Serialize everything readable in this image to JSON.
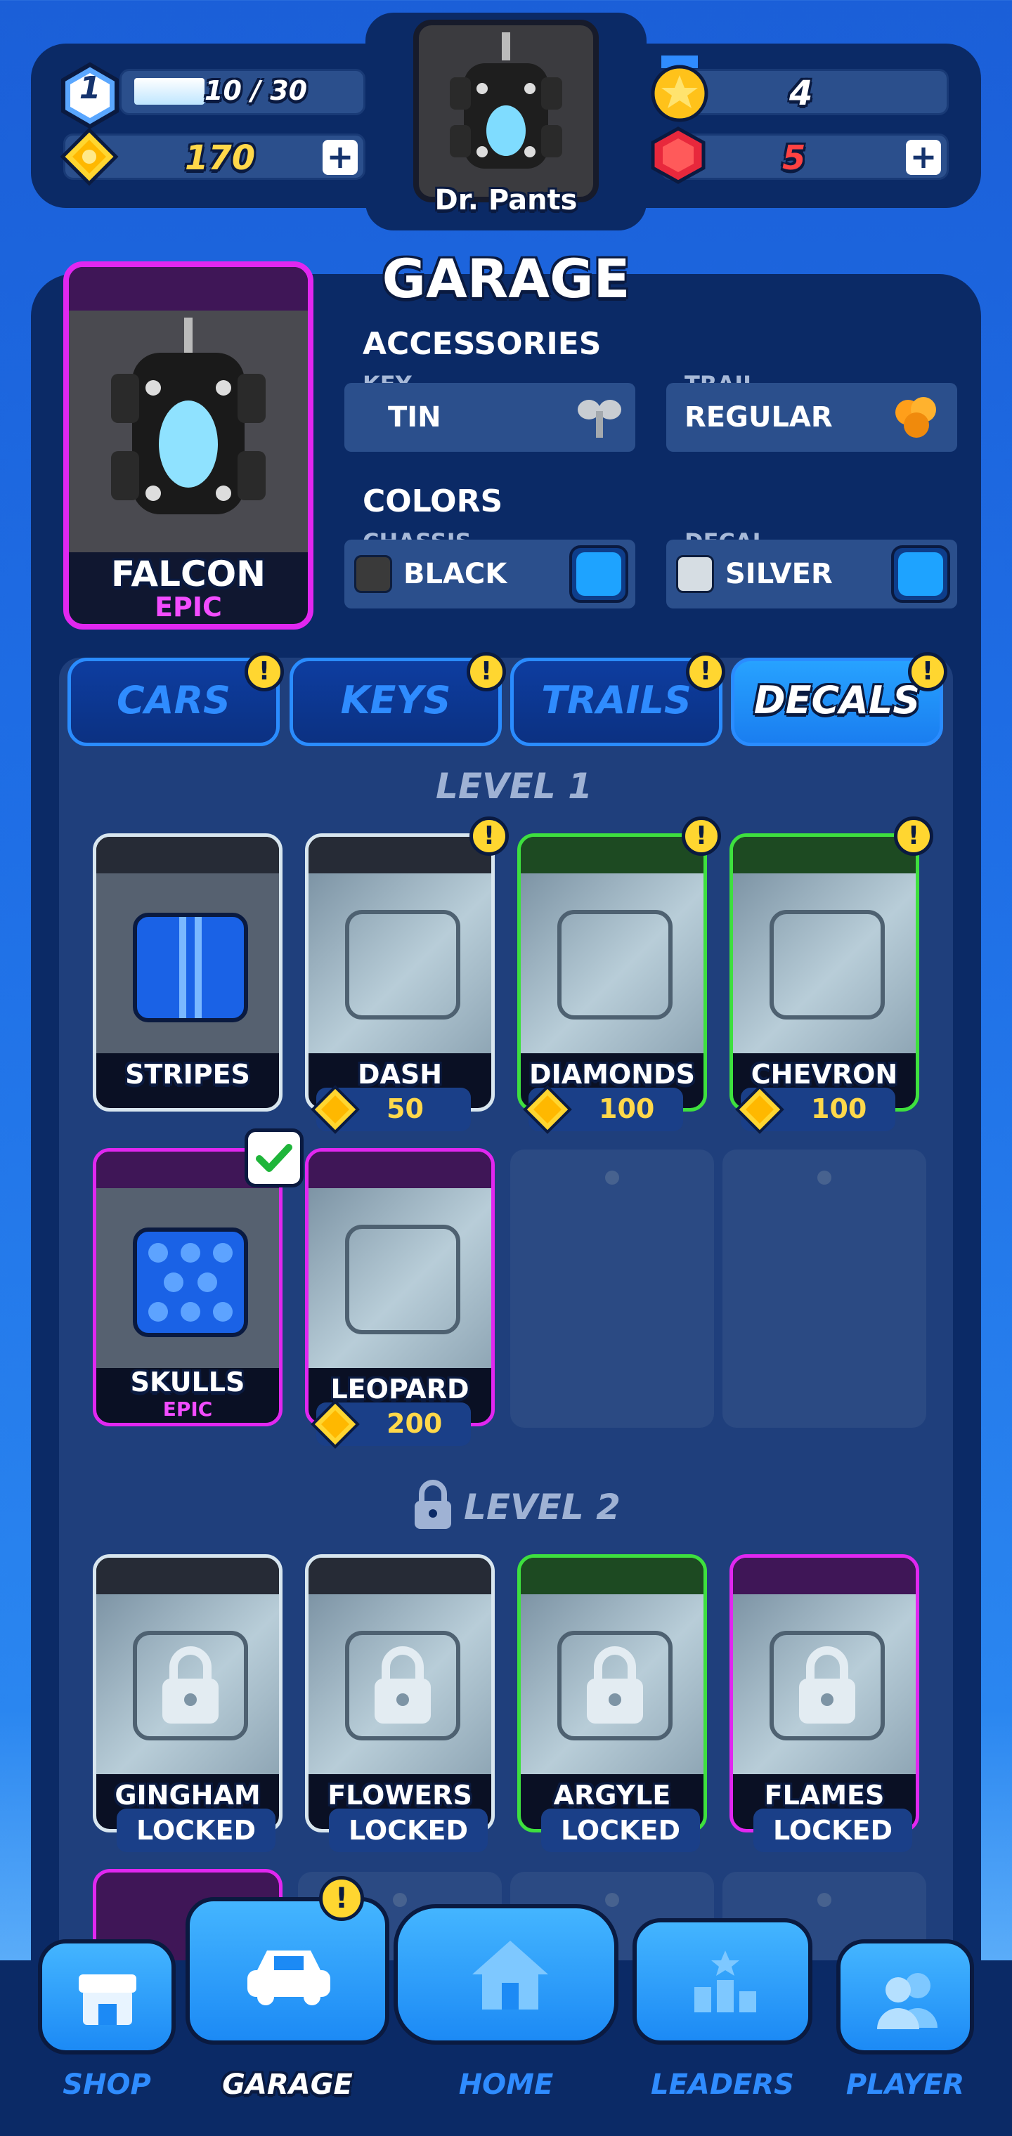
{
  "hud": {
    "level": "1",
    "xp": "10 / 30",
    "coins": "170",
    "stars": "4",
    "gems": "5",
    "plus": "+"
  },
  "profile": {
    "name": "Dr. Pants"
  },
  "garage": {
    "title": "GARAGE",
    "car": {
      "name": "FALCON",
      "rarity": "EPIC"
    },
    "accessories_heading": "ACCESSORIES",
    "key_label": "KEY",
    "key_value": "TIN",
    "trail_label": "TRAIL",
    "trail_value": "REGULAR",
    "colors_heading": "COLORS",
    "chassis_label": "CHASSIS",
    "chassis_value": "BLACK",
    "chassis_color": "#333333",
    "decal_label": "DECAL",
    "decal_value": "SILVER",
    "decal_color": "#d6dde3"
  },
  "tabs": [
    {
      "label": "CARS",
      "alert": "!"
    },
    {
      "label": "KEYS",
      "alert": "!"
    },
    {
      "label": "TRAILS",
      "alert": "!"
    },
    {
      "label": "DECALS",
      "alert": "!"
    }
  ],
  "level1": {
    "heading": "LEVEL 1",
    "decals": [
      {
        "name": "STRIPES"
      },
      {
        "name": "DASH",
        "price": "50"
      },
      {
        "name": "DIAMONDS",
        "price": "100"
      },
      {
        "name": "CHEVRON",
        "price": "100"
      },
      {
        "name": "SKULLS",
        "rarity": "EPIC"
      },
      {
        "name": "LEOPARD",
        "price": "200"
      }
    ]
  },
  "level2": {
    "heading": "LEVEL 2",
    "decals": [
      {
        "name": "GINGHAM",
        "status": "LOCKED"
      },
      {
        "name": "FLOWERS",
        "status": "LOCKED"
      },
      {
        "name": "ARGYLE",
        "status": "LOCKED"
      },
      {
        "name": "FLAMES",
        "status": "LOCKED"
      }
    ]
  },
  "nav": {
    "shop": "SHOP",
    "garage": "GARAGE",
    "home": "HOME",
    "leaders": "LEADERS",
    "player": "PLAYER",
    "garage_alert": "!"
  },
  "colors": {
    "panel": "#0b2a66",
    "accent_blue": "#2f8cff",
    "coin_gold": "#ffd84a",
    "epic_purple": "#e127f0",
    "gem_red": "#ff4242",
    "rare_green": "#3ee03e"
  }
}
